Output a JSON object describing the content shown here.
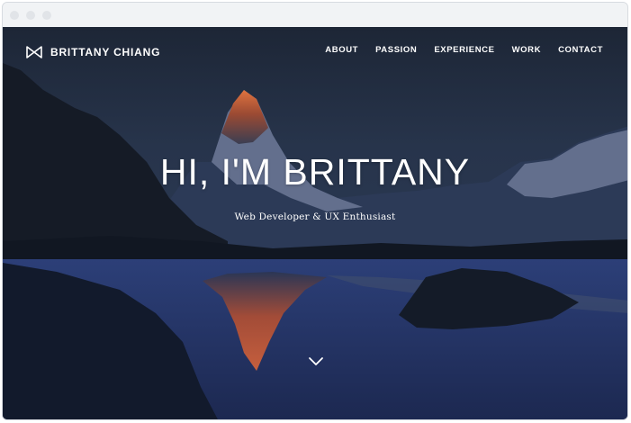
{
  "navbar": {
    "brand_name": "BRITTANY CHIANG",
    "links": [
      "ABOUT",
      "PASSION",
      "EXPERIENCE",
      "WORK",
      "CONTACT"
    ]
  },
  "hero": {
    "title": "HI, I'M BRITTANY",
    "subtitle": "Web Developer & UX Enthusiast"
  },
  "icons": {
    "logo": "bowtie-logo-icon",
    "scroll_down": "chevron-down-icon"
  },
  "colors": {
    "nav_text": "#ffffff",
    "hero_text": "#ffffff",
    "sky": "#27344b",
    "water": "#2b3c6a",
    "peak_glow": "#d96a3a"
  }
}
